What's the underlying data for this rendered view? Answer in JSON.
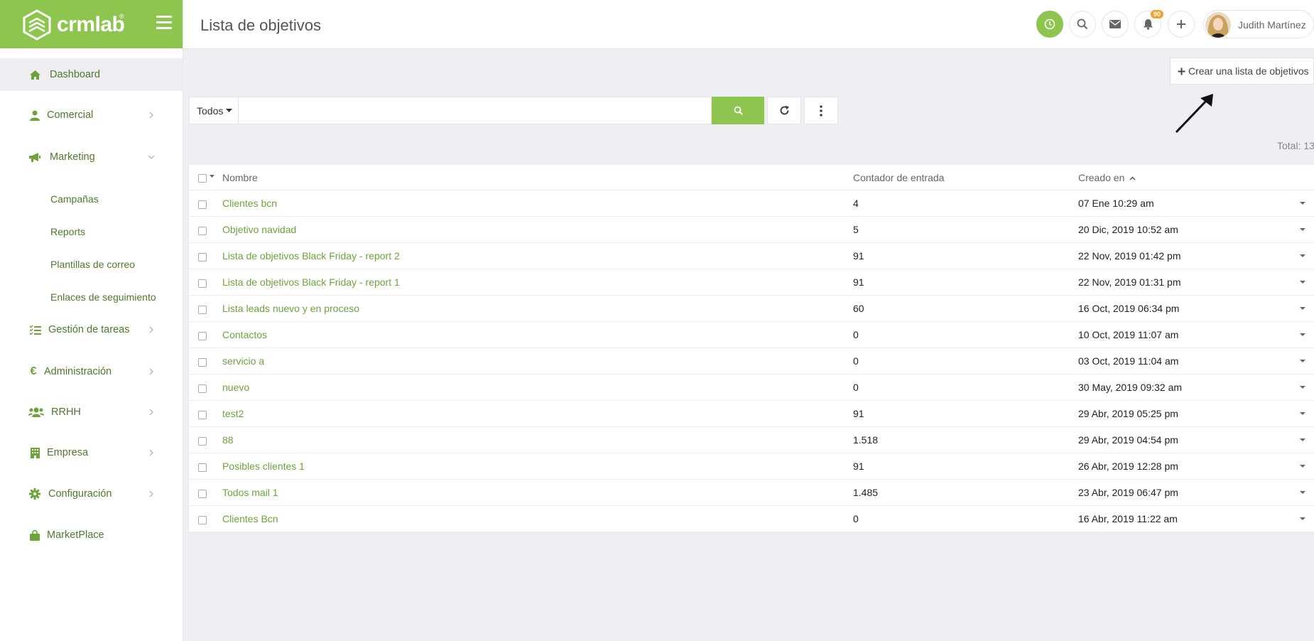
{
  "brand": {
    "name": "crmlab",
    "reg": "®"
  },
  "sidebar": {
    "items": [
      {
        "label": "Dashboard",
        "icon": "home-icon",
        "active": true,
        "chevron": "none"
      },
      {
        "label": "Comercial",
        "icon": "user-icon",
        "chevron": "right"
      },
      {
        "label": "Marketing",
        "icon": "megaphone-icon",
        "chevron": "down"
      },
      {
        "label": "Gestión de tareas",
        "icon": "tasks-icon",
        "chevron": "right"
      },
      {
        "label": "Administración",
        "icon": "euro-icon",
        "chevron": "right"
      },
      {
        "label": "RRHH",
        "icon": "users-icon",
        "chevron": "right"
      },
      {
        "label": "Empresa",
        "icon": "building-icon",
        "chevron": "right"
      },
      {
        "label": "Configuración",
        "icon": "gear-icon",
        "chevron": "right"
      },
      {
        "label": "MarketPlace",
        "icon": "bag-icon",
        "chevron": "none"
      }
    ],
    "marketing_sub": [
      "Campañas",
      "Reports",
      "Plantillas de correo",
      "Enlaces de seguimiento"
    ]
  },
  "header": {
    "title": "Lista de objetivos",
    "notification_count": "90",
    "user_name": "Judith Martínez"
  },
  "toolbar": {
    "create_label": "Crear una lista de objetivos",
    "filter_value": "Todos",
    "search_value": "",
    "total": "Total: 13"
  },
  "table": {
    "columns": [
      "Nombre",
      "Contador de entrada",
      "Creado en"
    ],
    "rows": [
      {
        "name": "Clientes bcn",
        "count": "4",
        "created": "07 Ene 10:29 am"
      },
      {
        "name": "Objetivo navidad",
        "count": "5",
        "created": "20 Dic, 2019 10:52 am"
      },
      {
        "name": "Lista de objetivos Black Friday - report 2",
        "count": "91",
        "created": "22 Nov, 2019 01:42 pm"
      },
      {
        "name": "Lista de objetivos Black Friday - report 1",
        "count": "91",
        "created": "22 Nov, 2019 01:31 pm"
      },
      {
        "name": "Lista leads nuevo y en proceso",
        "count": "60",
        "created": "16 Oct, 2019 06:34 pm"
      },
      {
        "name": "Contactos",
        "count": "0",
        "created": "10 Oct, 2019 11:07 am"
      },
      {
        "name": "servicio a",
        "count": "0",
        "created": "03 Oct, 2019 11:04 am"
      },
      {
        "name": "nuevo",
        "count": "0",
        "created": "30 May, 2019 09:32 am"
      },
      {
        "name": "test2",
        "count": "91",
        "created": "29 Abr, 2019 05:25 pm"
      },
      {
        "name": "88",
        "count": "1.518",
        "created": "29 Abr, 2019 04:54 pm"
      },
      {
        "name": "Posibles clientes 1",
        "count": "91",
        "created": "26 Abr, 2019 12:28 pm"
      },
      {
        "name": "Todos mail 1",
        "count": "1.485",
        "created": "23 Abr, 2019 06:47 pm"
      },
      {
        "name": "Clientes Bcn",
        "count": "0",
        "created": "16 Abr, 2019 11:22 am"
      }
    ]
  },
  "colors": {
    "brand_green": "#8dc54f",
    "link_green": "#6ca43a",
    "nav_green": "#4d7a2a",
    "badge": "#f0a430"
  }
}
